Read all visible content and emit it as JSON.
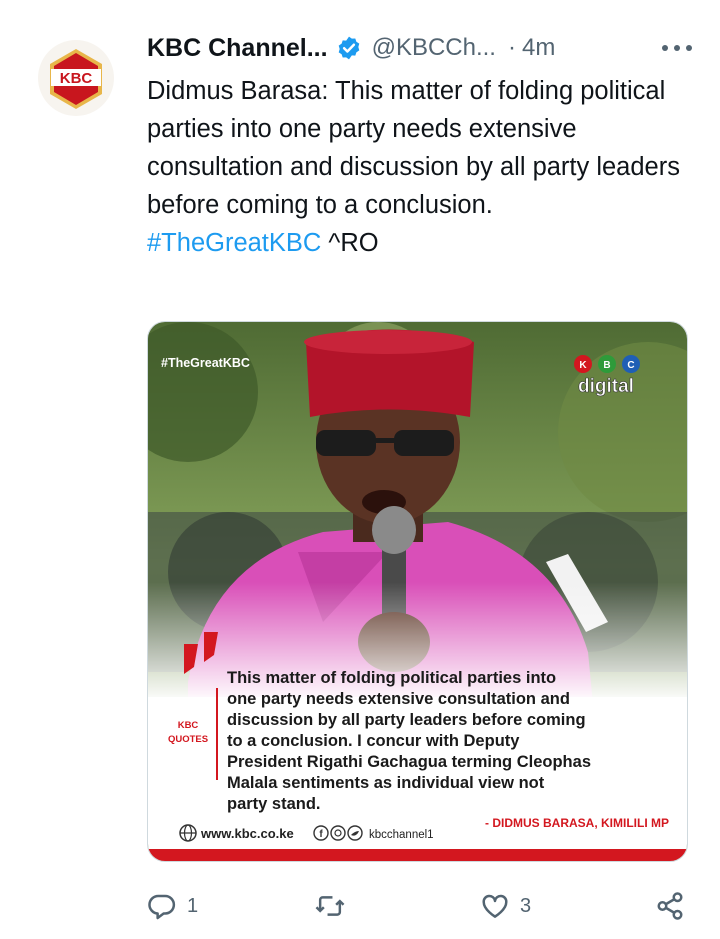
{
  "account": {
    "display_name": "KBC Channel...",
    "handle": "@KBCCh...",
    "dot": "·",
    "time": "4m",
    "avatar_text": "KBC"
  },
  "tweet": {
    "text": "Didmus Barasa: This matter of folding political parties into one party needs extensive consultation and discussion by all party leaders before coming to a conclusion.",
    "hashtag": "#TheGreatKBC",
    "suffix": " ^RO"
  },
  "media": {
    "tag": "#TheGreatKBC",
    "logo_letters": [
      "K",
      "B",
      "C"
    ],
    "logo_word": "digital",
    "quote_lines": [
      "This matter of folding political parties into",
      "one party needs extensive consultation and",
      "discussion by all party leaders before coming",
      "to a conclusion. I concur with Deputy",
      "President Rigathi Gachagua terming Cleophas",
      "Malala sentiments as individual view not",
      "party stand."
    ],
    "label_line1": "KBC",
    "label_line2": "QUOTES",
    "attribution": "- DIDMUS BARASA, KIMILILI MP",
    "website": "www.kbc.co.ke",
    "social_handle": "kbcchannel1",
    "colors": {
      "red": "#d3171f",
      "cap": "#b3142a",
      "shirt": "#d94fb8"
    }
  },
  "actions": {
    "reply_count": "1",
    "retweet_count": "",
    "like_count": "3"
  },
  "colors": {
    "link": "#1d9bf0",
    "muted": "#536471",
    "verified": "#1d9bf0"
  },
  "icons": [
    "kbc-logo",
    "verified-badge-icon",
    "more-options-icon",
    "reply-icon",
    "retweet-icon",
    "like-icon",
    "share-icon",
    "globe-icon",
    "facebook-icon",
    "instagram-icon",
    "twitter-icon"
  ]
}
